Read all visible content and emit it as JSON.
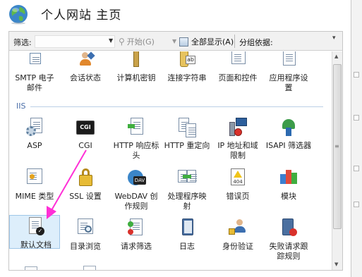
{
  "header": {
    "title": "个人网站 主页",
    "icon": "globe-icon"
  },
  "toolbar": {
    "filter_label": "筛选:",
    "filter_value": "",
    "start_label": "开始(G)",
    "show_all_label": "全部显示(A)",
    "group_by_label": "分组依据:"
  },
  "rows": {
    "top": [
      {
        "label": "SMTP 电子\n邮件",
        "icon": "smtp-mail-icon"
      },
      {
        "label": "会话状态",
        "icon": "session-state-icon"
      },
      {
        "label": "计算机密钥",
        "icon": "machine-key-icon"
      },
      {
        "label": "连接字符串",
        "icon": "connection-strings-icon"
      },
      {
        "label": "页面和控件",
        "icon": "pages-controls-icon"
      },
      {
        "label": "应用程序设\n置",
        "icon": "app-settings-icon"
      }
    ],
    "iis_label": "IIS",
    "row1": [
      {
        "label": "ASP",
        "icon": "asp-icon"
      },
      {
        "label": "CGI",
        "icon": "cgi-icon"
      },
      {
        "label": "HTTP 响应标\n头",
        "icon": "http-headers-icon"
      },
      {
        "label": "HTTP 重定向",
        "icon": "http-redirect-icon"
      },
      {
        "label": "IP 地址和域\n限制",
        "icon": "ip-restrictions-icon"
      },
      {
        "label": "ISAPI 筛选器",
        "icon": "isapi-filters-icon"
      }
    ],
    "row2": [
      {
        "label": "MIME 类型",
        "icon": "mime-types-icon"
      },
      {
        "label": "SSL 设置",
        "icon": "ssl-settings-icon"
      },
      {
        "label": "WebDAV 创\n作规则",
        "icon": "webdav-icon"
      },
      {
        "label": "处理程序映\n射",
        "icon": "handler-mappings-icon"
      },
      {
        "label": "错误页",
        "icon": "error-pages-icon"
      },
      {
        "label": "模块",
        "icon": "modules-icon"
      }
    ],
    "row3": [
      {
        "label": "默认文档",
        "icon": "default-document-icon"
      },
      {
        "label": "目录浏览",
        "icon": "directory-browsing-icon"
      },
      {
        "label": "请求筛选",
        "icon": "request-filtering-icon"
      },
      {
        "label": "日志",
        "icon": "logging-icon"
      },
      {
        "label": "身份验证",
        "icon": "authentication-icon"
      },
      {
        "label": "失败请求跟\n踪规则",
        "icon": "failed-request-tracing-icon"
      }
    ],
    "cgi_badge": "CGI",
    "error_badge": "404",
    "webdav_badge": "DAV"
  },
  "colors": {
    "accent": "#ff2fd6",
    "selection": "#ddeefb",
    "section": "#4a6ea8"
  }
}
